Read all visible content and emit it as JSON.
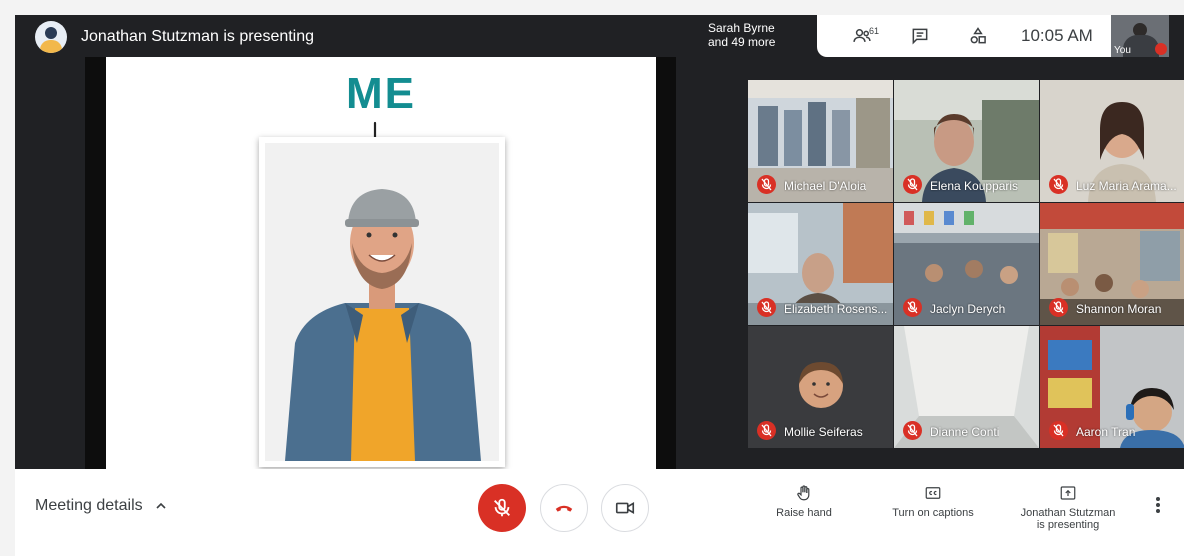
{
  "presenter_bar": {
    "title": "Jonathan Stutzman is presenting",
    "avatar_icon": "presenter-avatar"
  },
  "top_right": {
    "more_people_name": "Sarah Byrne",
    "more_people_rest": "and 49 more",
    "participants_count": "61",
    "participants_icon": "people-icon",
    "chat_icon": "chat-icon",
    "activities_icon": "activities-icon",
    "clock": "10:05 AM",
    "self_label": "You"
  },
  "slide": {
    "heading": "ME",
    "accent_color": "#138d91",
    "arrow_icon": "arrow-down-icon"
  },
  "participants": [
    {
      "name": "Michael D'Aloia",
      "muted": true
    },
    {
      "name": "Elena Koupparis",
      "muted": true
    },
    {
      "name": "Luz Maria Arama...",
      "muted": true
    },
    {
      "name": "Elizabeth Rosens...",
      "muted": true
    },
    {
      "name": "Jaclyn Derych",
      "muted": true
    },
    {
      "name": "Shannon Moran",
      "muted": true
    },
    {
      "name": "Mollie Seiferas",
      "muted": true
    },
    {
      "name": "Dianne Conti",
      "muted": true
    },
    {
      "name": "Aaron Tran",
      "muted": true
    }
  ],
  "bottom_bar": {
    "meeting_details": "Meeting details",
    "chevron_icon": "chevron-up-icon",
    "mic_icon": "mic-off-icon",
    "hangup_icon": "hang-up-icon",
    "camera_icon": "camera-icon",
    "raise_hand": "Raise hand",
    "captions": "Turn on captions",
    "presenting_line1": "Jonathan Stutzman",
    "presenting_line2": "is presenting",
    "more_icon": "more-vert-icon"
  },
  "colors": {
    "stage_bg": "#202124",
    "danger": "#d93025",
    "text": "#3c4043"
  }
}
